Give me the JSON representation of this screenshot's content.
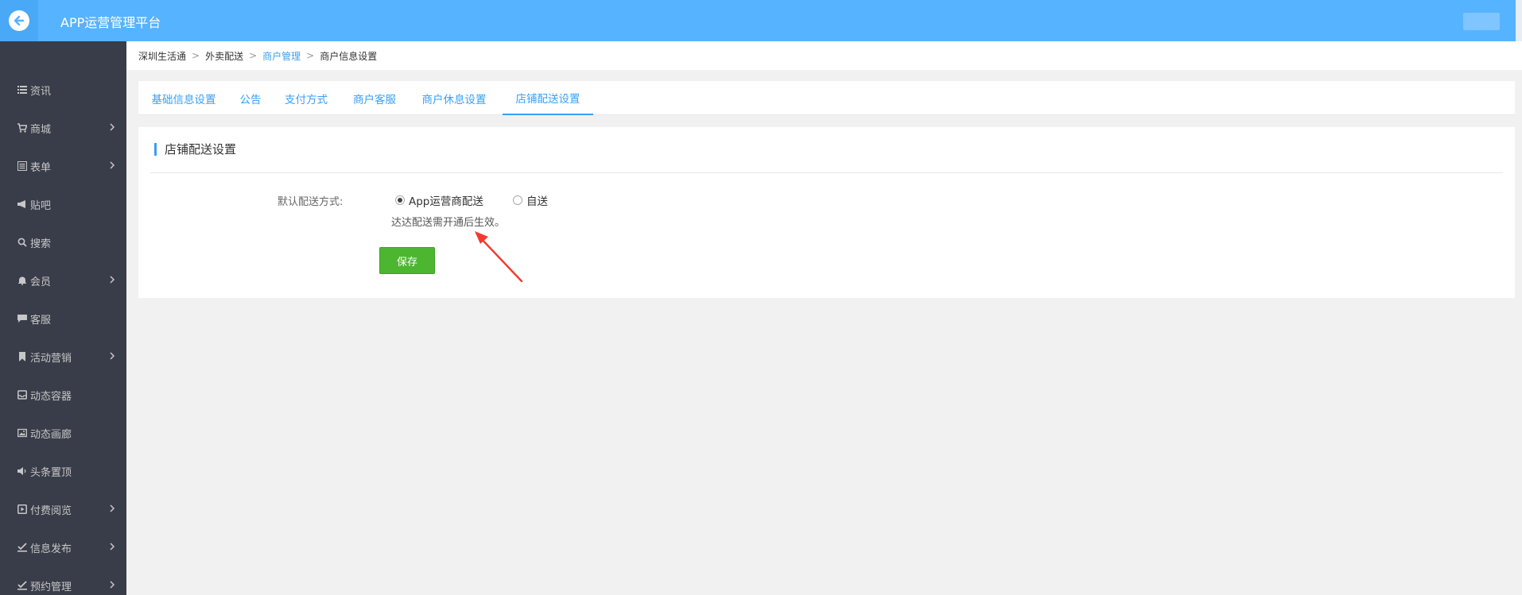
{
  "header": {
    "title": "APP运营管理平台"
  },
  "sidebar": {
    "items": [
      {
        "label": "资讯",
        "icon": "list-icon",
        "has_arrow": false
      },
      {
        "label": "商城",
        "icon": "cart-icon",
        "has_arrow": true
      },
      {
        "label": "表单",
        "icon": "form-icon",
        "has_arrow": true
      },
      {
        "label": "贴吧",
        "icon": "megaphone-icon",
        "has_arrow": false
      },
      {
        "label": "搜索",
        "icon": "search-icon",
        "has_arrow": false
      },
      {
        "label": "会员",
        "icon": "bell-icon",
        "has_arrow": true
      },
      {
        "label": "客服",
        "icon": "chat-icon",
        "has_arrow": false
      },
      {
        "label": "活动营销",
        "icon": "bookmark-icon",
        "has_arrow": true
      },
      {
        "label": "动态容器",
        "icon": "inbox-icon",
        "has_arrow": false
      },
      {
        "label": "动态画廊",
        "icon": "image-icon",
        "has_arrow": false
      },
      {
        "label": "头条置顶",
        "icon": "speaker-icon",
        "has_arrow": false
      },
      {
        "label": "付费阅览",
        "icon": "play-square-icon",
        "has_arrow": true
      },
      {
        "label": "信息发布",
        "icon": "check-edit-icon",
        "has_arrow": true
      },
      {
        "label": "预约管理",
        "icon": "check-edit-icon",
        "has_arrow": true
      }
    ]
  },
  "breadcrumb": [
    "深圳生活通",
    "外卖配送",
    "商户管理",
    "商户信息设置"
  ],
  "tabs": [
    "基础信息设置",
    "公告",
    "支付方式",
    "商户客服",
    "商户休息设置",
    "店铺配送设置"
  ],
  "panel": {
    "title": "店铺配送设置",
    "field_label": "默认配送方式:",
    "options": [
      {
        "label": "App运营商配送",
        "checked": true
      },
      {
        "label": "自送",
        "checked": false
      }
    ],
    "hint": "达达配送需开通后生效。",
    "save_label": "保存"
  },
  "colors": {
    "accent": "#56b3ff",
    "sidebar": "#393d49",
    "save": "#4cb630",
    "annotation_arrow": "#f23a2f"
  }
}
